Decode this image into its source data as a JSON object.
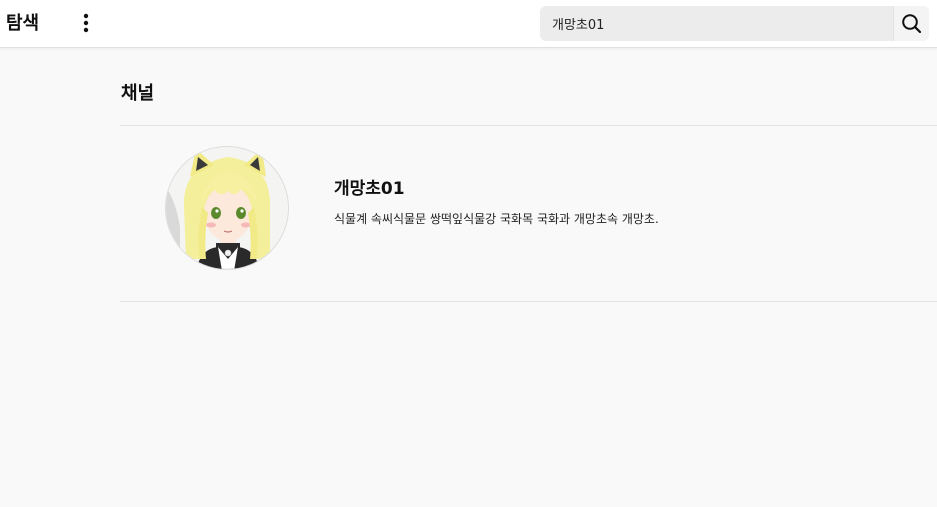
{
  "header": {
    "title": "탐색",
    "more_icon": "vertical-ellipsis-icon",
    "search": {
      "value": "개망초01",
      "placeholder": "",
      "button_icon": "search-icon"
    }
  },
  "section": {
    "title": "채널"
  },
  "channels": [
    {
      "name": "개망초01",
      "description": "식물계 속씨식물문 쌍떡잎식물강 국화목 국화과 개망초속 개망초.",
      "avatar_icon": "avatar-anime-character"
    }
  ],
  "colors": {
    "background": "#f9f9f9",
    "header_bg": "#ffffff",
    "search_bg": "#ececec",
    "text": "#111111"
  }
}
